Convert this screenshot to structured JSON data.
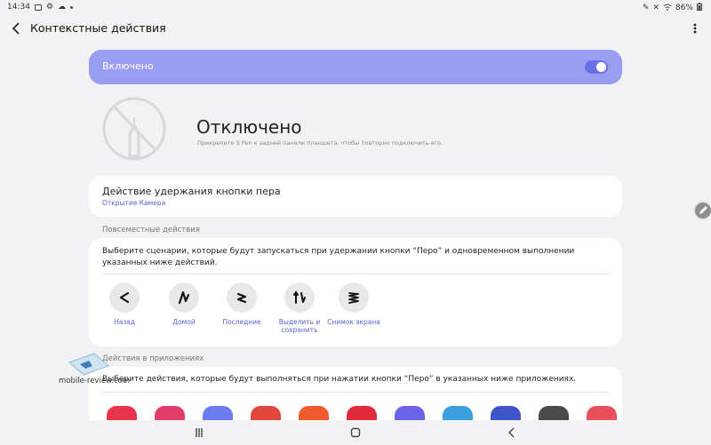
{
  "status_bar": {
    "time": "14:34",
    "battery": "86%"
  },
  "header": {
    "title": "Контекстные действия"
  },
  "master_switch": {
    "label": "Включено",
    "state": "on",
    "color": "#9a9ef2"
  },
  "pen": {
    "status": "Отключено",
    "description": "Прикрепите S Pen к задней панели планшета, чтобы повторно подключить его."
  },
  "hold_action": {
    "title": "Действие удержания кнопки пера",
    "value": "Открытие Камера"
  },
  "anywhere": {
    "section_label": "Повсеместные действия",
    "description": "Выберите сценарии, которые будут запускаться при удержании кнопки “Перо” и одновременном выполнении указанных ниже действий.",
    "gestures": [
      {
        "label": "Назад",
        "icon": "gesture-back-icon"
      },
      {
        "label": "Домой",
        "icon": "gesture-home-icon"
      },
      {
        "label": "Последние",
        "icon": "gesture-recents-icon"
      },
      {
        "label": "Выделить и сохранить",
        "icon": "gesture-select-icon"
      },
      {
        "label": "Снимок экрана",
        "icon": "gesture-screenshot-icon"
      }
    ]
  },
  "app_actions": {
    "section_label": "Действия в приложениях",
    "description": "Выберите действия, которые будут выполняться при нажатии кнопки “Перо” в указанных ниже приложениях.",
    "apps": [
      {
        "icon": "camera-app-icon",
        "color": "#e8334a"
      },
      {
        "icon": "gallery-app-icon",
        "color": "#e23d6a"
      },
      {
        "icon": "browser-app-icon",
        "color": "#6d7cf0"
      },
      {
        "icon": "voice-recorder-app-icon",
        "color": "#e2473d"
      },
      {
        "icon": "slides-app-icon",
        "color": "#ef5b2f"
      },
      {
        "icon": "music-app-icon",
        "color": "#e22b3a"
      },
      {
        "icon": "video-app-icon",
        "color": "#6b63e8"
      },
      {
        "icon": "notes-app-icon",
        "color": "#3aa0e0"
      },
      {
        "icon": "calendar-app-icon",
        "color": "#3f55c8"
      },
      {
        "icon": "pdf-app-icon",
        "color": "#4a4a4a"
      },
      {
        "icon": "reader-app-icon",
        "color": "#e8505b"
      }
    ]
  },
  "watermark": {
    "text": "mobile-review.com"
  }
}
